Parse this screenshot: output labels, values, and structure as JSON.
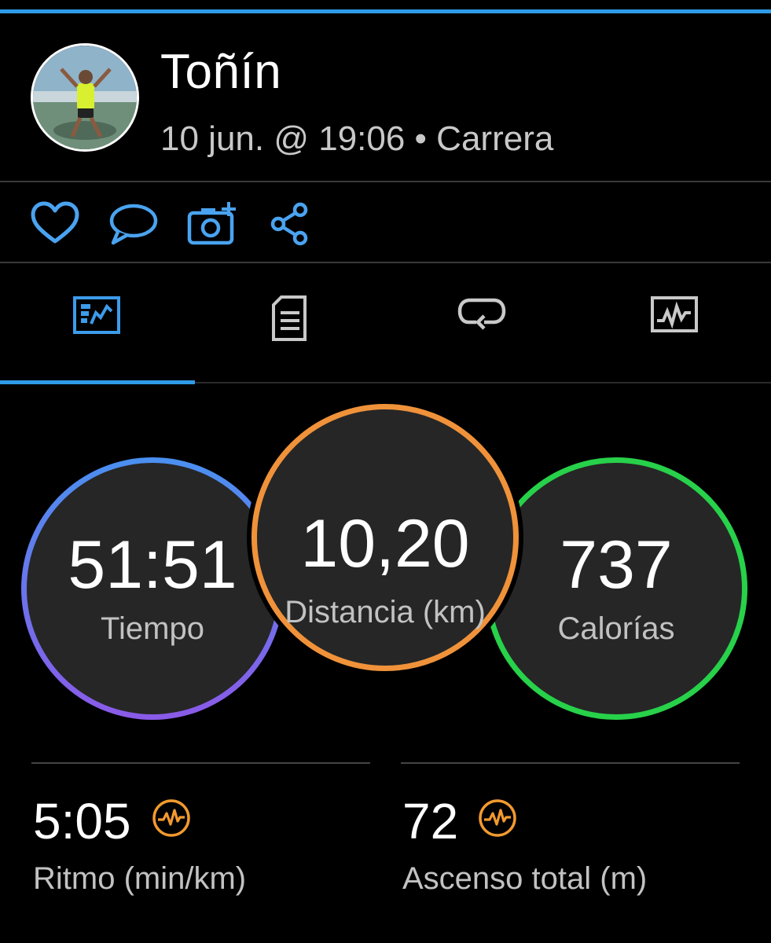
{
  "header": {
    "name": "Toñín",
    "subtitle": "10 jun. @ 19:06 • Carrera"
  },
  "actions": [
    "heart-icon",
    "comment-icon",
    "add-photo-icon",
    "share-icon"
  ],
  "tabs": [
    "overview-tab",
    "details-tab",
    "laps-tab",
    "charts-tab"
  ],
  "colors": {
    "accent": "#2f9be8",
    "time_ring": "#5b7cf0",
    "distance_ring": "#f0923a",
    "calories_ring": "#27d14a",
    "badge": "#f29a2e"
  },
  "metrics": {
    "time": {
      "value": "51:51",
      "label": "Tiempo"
    },
    "distance": {
      "value": "10,20",
      "label": "Distancia (km)"
    },
    "calories": {
      "value": "737",
      "label": "Calorías"
    }
  },
  "stats": {
    "pace": {
      "value": "5:05",
      "label": "Ritmo (min/km)"
    },
    "ascent": {
      "value": "72",
      "label": "Ascenso total (m)"
    }
  }
}
